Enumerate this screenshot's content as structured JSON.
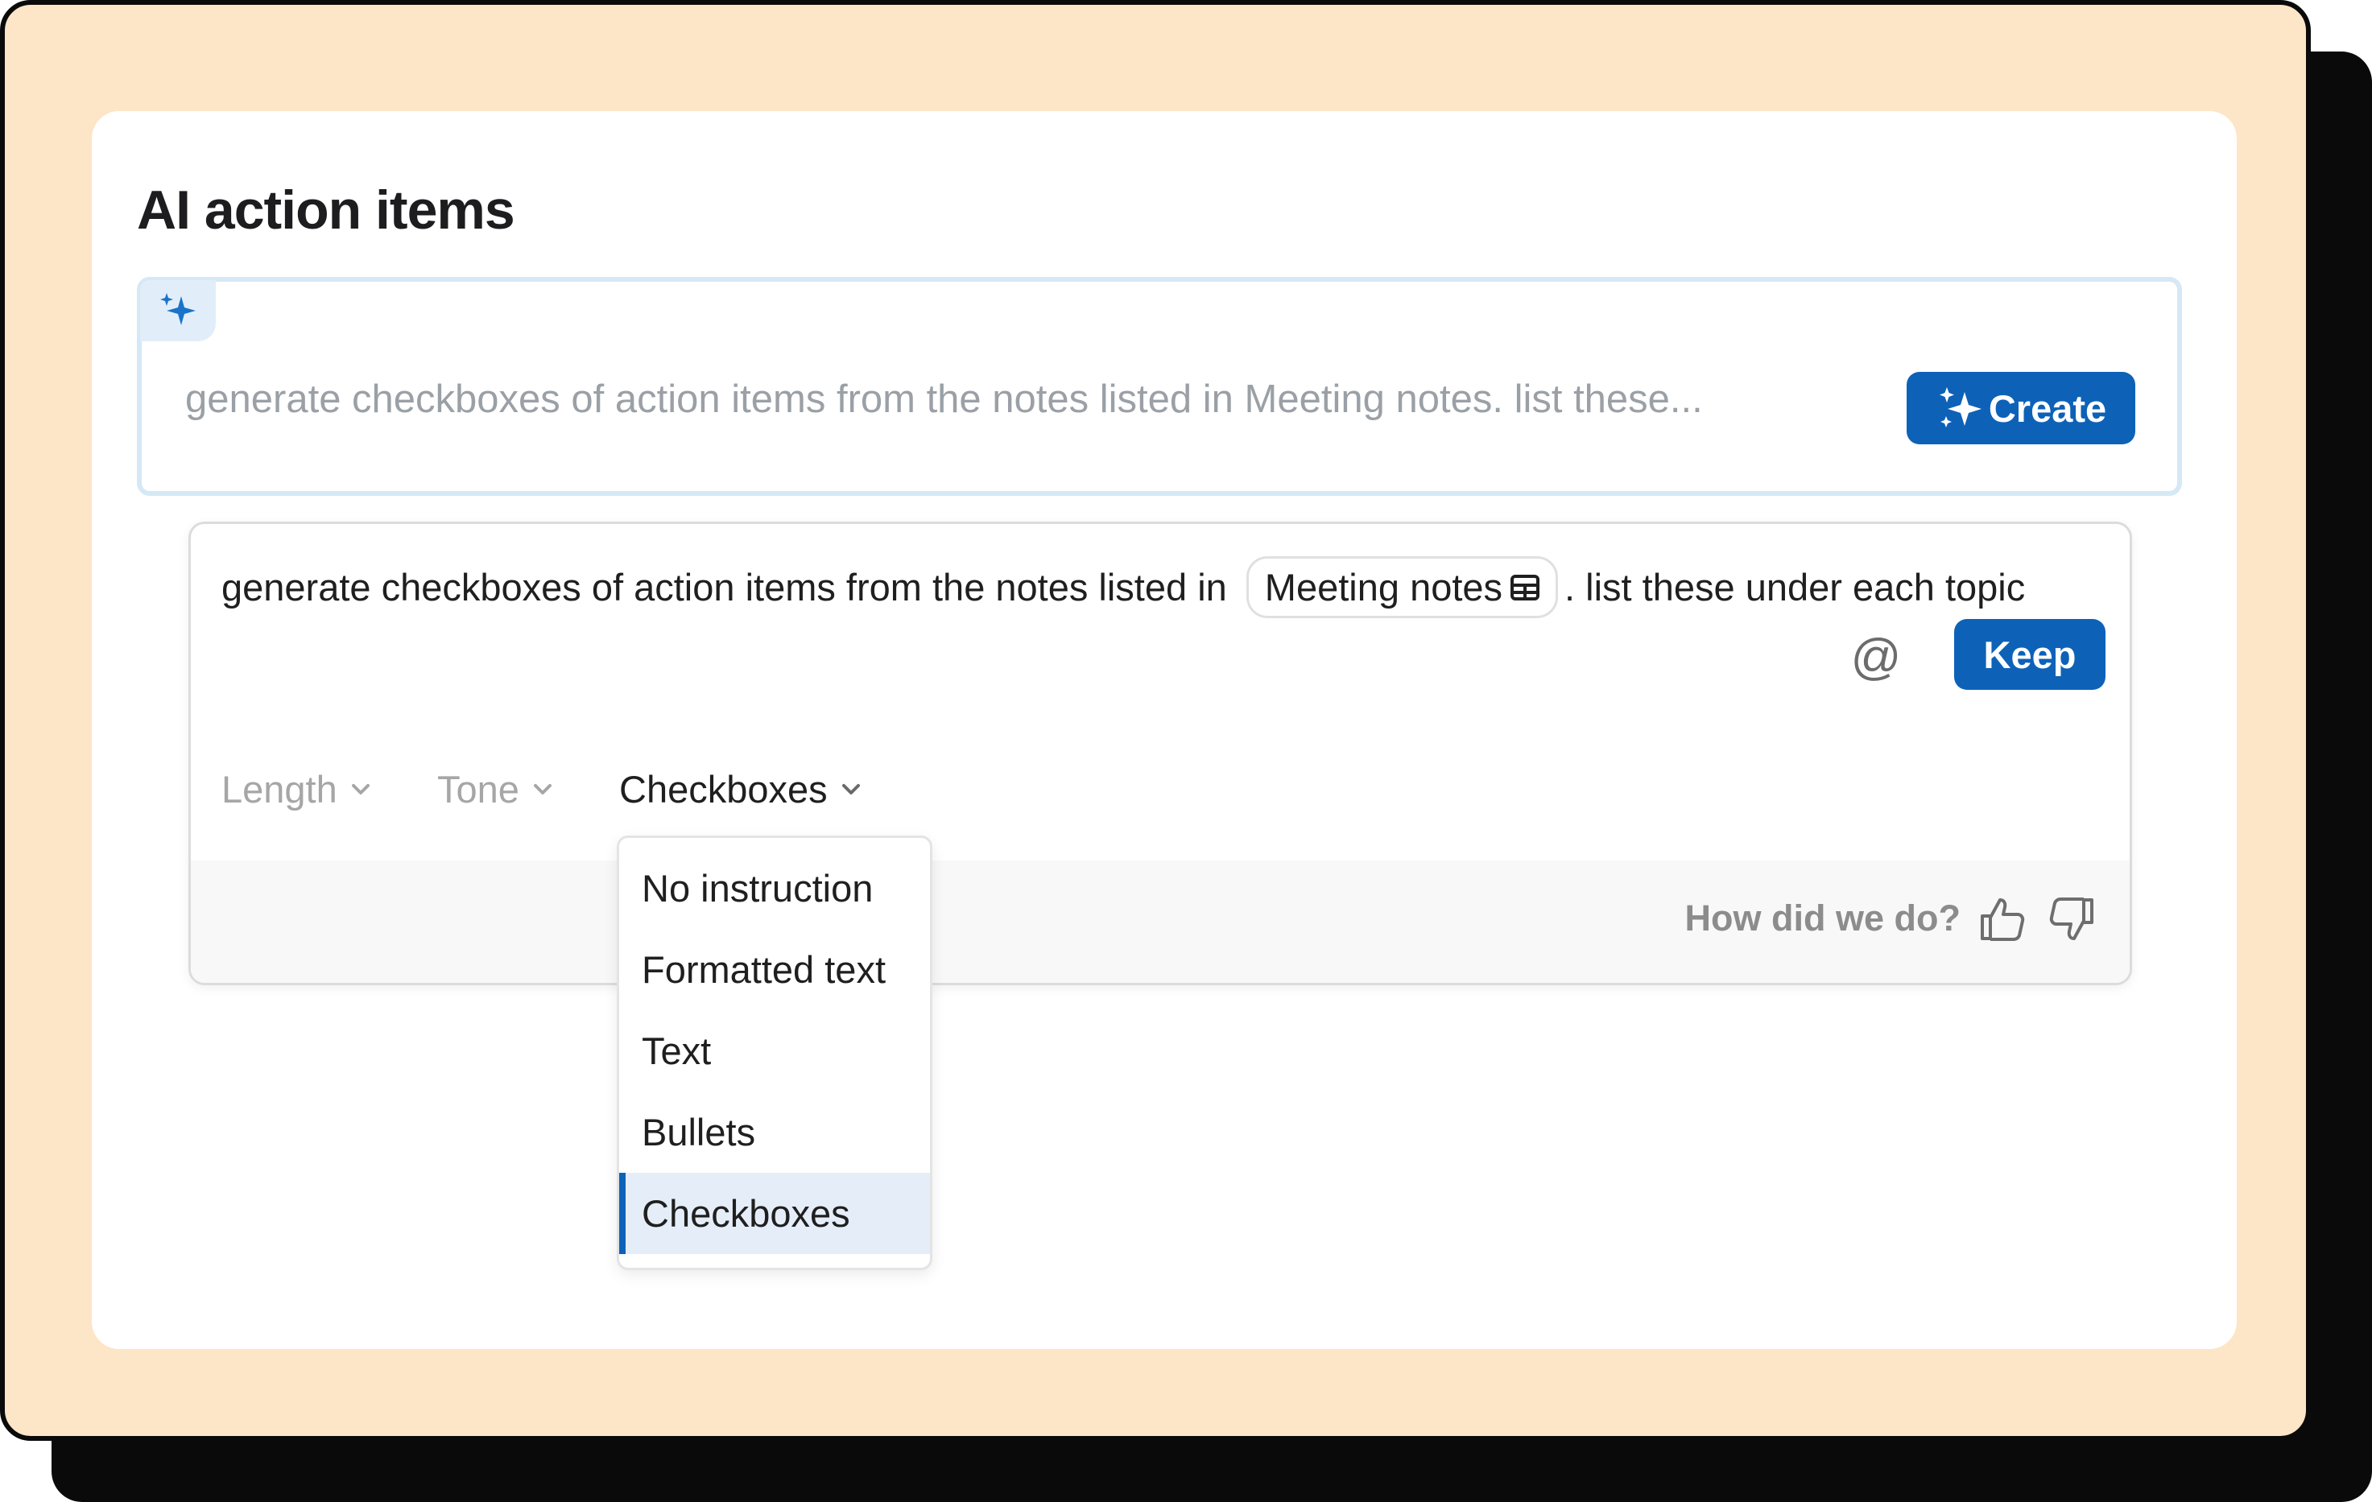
{
  "title": "AI action items",
  "prompt": {
    "placeholder": "generate checkboxes of action items from the notes listed in Meeting notes. list these...",
    "create_label": "Create"
  },
  "result": {
    "text_before": "generate checkboxes of action items from the notes listed in",
    "mention": "Meeting notes",
    "text_after": ". list these under each topic",
    "keep_label": "Keep"
  },
  "options": {
    "length": "Length",
    "tone": "Tone",
    "format": "Checkboxes"
  },
  "feedback": {
    "label": "How did we do?"
  },
  "dropdown": {
    "items": [
      "No instruction",
      "Formatted text",
      "Text",
      "Bullets",
      "Checkboxes"
    ],
    "selected": "Checkboxes"
  },
  "icons": {
    "sparkle": "sparkle-icon",
    "at": "at-icon",
    "table": "table-icon",
    "chevron": "chevron-down-icon",
    "thumbs_up": "thumbs-up-icon",
    "thumbs_down": "thumbs-down-icon"
  },
  "colors": {
    "background_frame": "#fde5c7",
    "accent": "#0d62b8",
    "prompt_border": "#d5e8f5",
    "selected_item": "#e5eef8"
  }
}
